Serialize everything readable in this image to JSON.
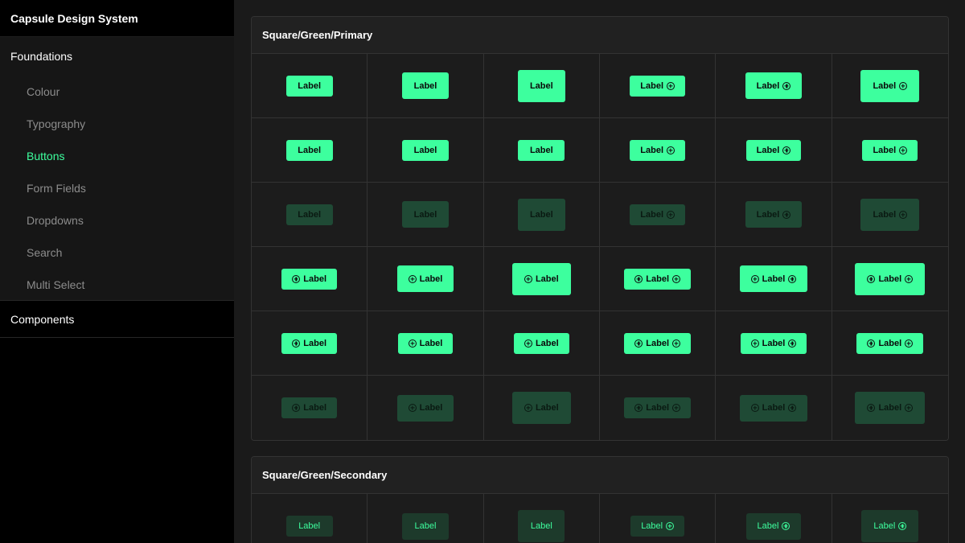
{
  "sidebar": {
    "title": "Capsule Design System",
    "foundations_heading": "Foundations",
    "items": [
      {
        "label": "Colour",
        "active": false
      },
      {
        "label": "Typography",
        "active": false
      },
      {
        "label": "Buttons",
        "active": true
      },
      {
        "label": "Form Fields",
        "active": false
      },
      {
        "label": "Dropdowns",
        "active": false
      },
      {
        "label": "Search",
        "active": false
      },
      {
        "label": "Multi Select",
        "active": false
      }
    ],
    "components_heading": "Components"
  },
  "colors": {
    "accent": "#3dff9e",
    "disabled_bg": "#1f4a35",
    "secondary_bg": "#1d3a2b"
  },
  "sections": [
    {
      "title": "Square/Green/Primary",
      "button_label": "Label",
      "icon": "plus-circle-icon"
    },
    {
      "title": "Square/Green/Secondary",
      "button_label": "Label",
      "icon": "plus-circle-icon"
    }
  ]
}
